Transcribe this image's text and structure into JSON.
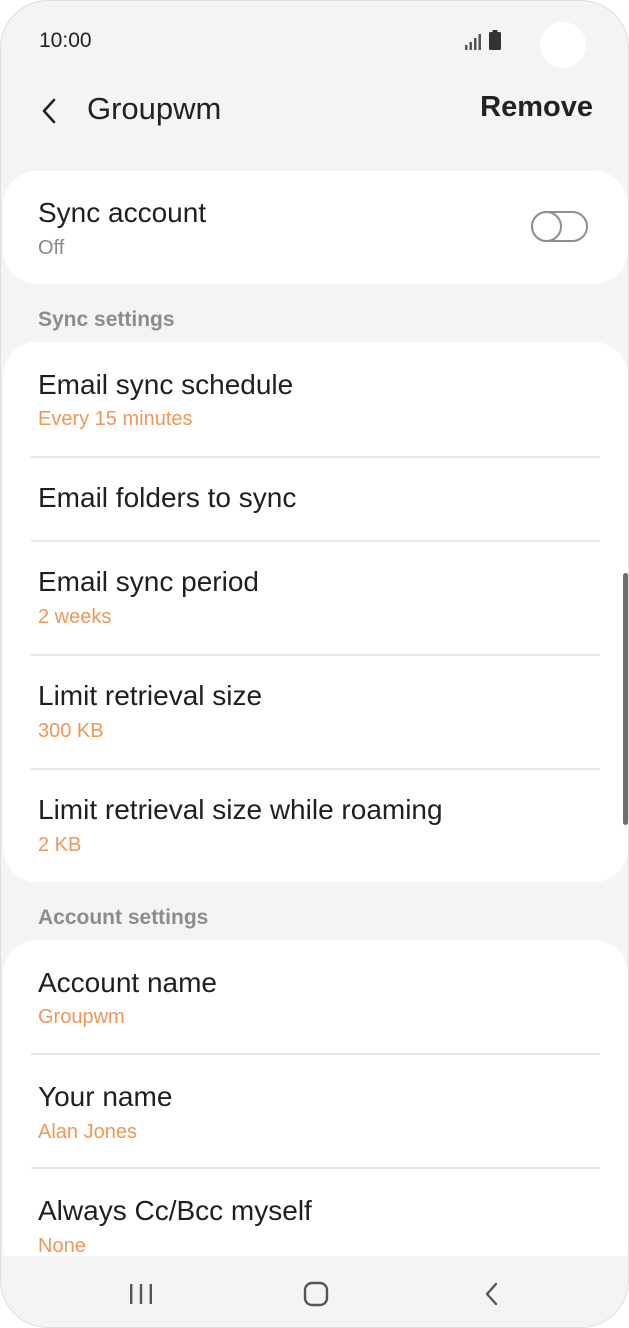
{
  "status_bar": {
    "time": "10:00"
  },
  "header": {
    "title": "Groupwm",
    "remove_label": "Remove"
  },
  "sync_account": {
    "title": "Sync account",
    "state": "Off",
    "enabled": false
  },
  "sync_settings": {
    "section_label": "Sync settings",
    "items": [
      {
        "title": "Email sync schedule",
        "value": "Every 15 minutes"
      },
      {
        "title": "Email folders to sync",
        "value": ""
      },
      {
        "title": "Email sync period",
        "value": "2 weeks"
      },
      {
        "title": "Limit retrieval size",
        "value": "300 KB"
      },
      {
        "title": "Limit retrieval size while roaming",
        "value": "2 KB"
      }
    ]
  },
  "account_settings": {
    "section_label": "Account settings",
    "items": [
      {
        "title": "Account name",
        "value": "Groupwm"
      },
      {
        "title": "Your name",
        "value": "Alan Jones"
      },
      {
        "title": "Always Cc/Bcc myself",
        "value": "None"
      }
    ]
  },
  "icons": {
    "back": "chevron-left-icon",
    "signal": "signal-icon",
    "battery": "battery-icon",
    "recents": "recents-icon",
    "home": "home-icon",
    "nav_back": "back-icon"
  },
  "colors": {
    "accent": "#ef9658",
    "background": "#f4f4f4",
    "card": "#ffffff"
  }
}
